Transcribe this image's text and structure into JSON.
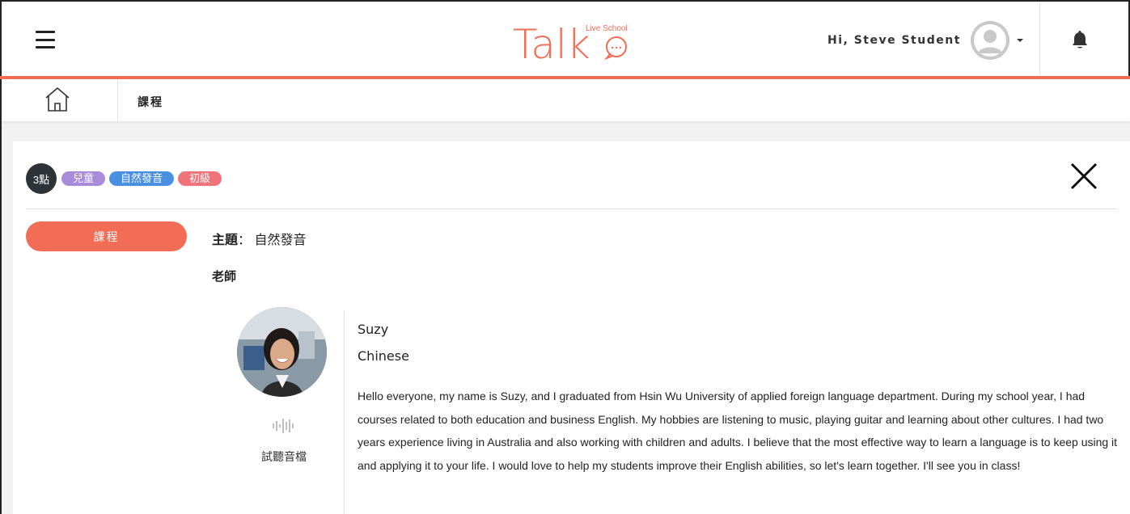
{
  "header": {
    "logo_main": "Talk",
    "logo_super": "Live School",
    "greeting": "Hi, Steve Student"
  },
  "breadcrumb": {
    "current": "課程"
  },
  "course": {
    "points_badge": "3點",
    "tags": [
      {
        "label": "兒童",
        "color": "#a98bdc"
      },
      {
        "label": "自然發音",
        "color": "#4a90e2"
      },
      {
        "label": "初級",
        "color": "#f0727a"
      }
    ],
    "tab_label": "課程",
    "topic_label": "主題",
    "topic_separator": "：",
    "topic_value": "自然發音",
    "teacher_heading": "老師"
  },
  "teacher": {
    "name": "Suzy",
    "language": "Chinese",
    "audio_label": "試聽音檔",
    "bio": "Hello everyone, my name is Suzy, and I graduated from Hsin Wu University of applied foreign language department. During my school year, I had courses related to both education and business English. My hobbies are listening to music, playing guitar and learning about other cultures. I had two years experience living in Australia and also working with children and adults. I believe that the most effective way to learn a language is to keep using it and applying it to your life. I would love to help my students improve their English abilities, so let's learn together. I'll see you in class!"
  },
  "colors": {
    "accent": "#f26c56",
    "dark": "#2e3338"
  }
}
